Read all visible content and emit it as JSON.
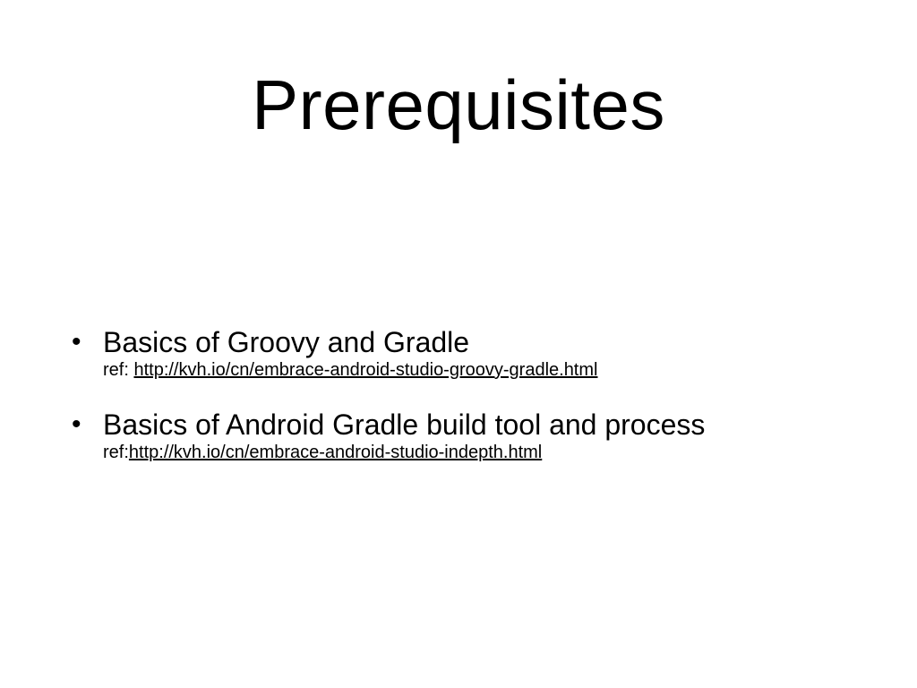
{
  "slide": {
    "title": "Prerequisites",
    "bullets": [
      {
        "heading": "Basics of Groovy and Gradle",
        "ref_prefix": "ref: ",
        "link_text": "http://kvh.io/cn/embrace-android-studio-groovy-gradle.html"
      },
      {
        "heading": "Basics of Android Gradle build tool and process",
        "ref_prefix": "ref:",
        "link_text": "http://kvh.io/cn/embrace-android-studio-indepth.html"
      }
    ],
    "bullet_glyph": "•"
  }
}
